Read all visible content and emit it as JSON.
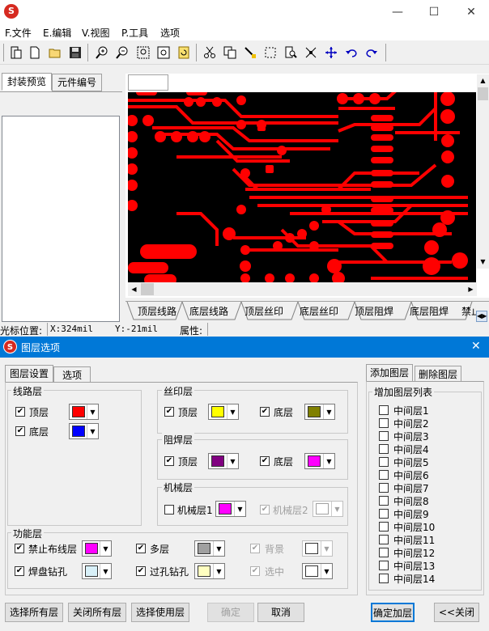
{
  "window": {
    "app_icon": "app-logo-icon",
    "min": "—",
    "max": "☐",
    "close": "✕"
  },
  "menu": [
    "F.文件",
    "E.编辑",
    "V.视图",
    "P.工具",
    "选项"
  ],
  "left_tabs": [
    "封装预览",
    "元件编号"
  ],
  "layer_tabs": [
    "顶层线路",
    "底层线路",
    "顶层丝印",
    "底层丝印",
    "顶层阻焊",
    "底层阻焊",
    "禁止布"
  ],
  "status": {
    "cursor_label": "光标位置:",
    "x": "X:324mil",
    "y": "Y:-21mil",
    "attr_label": "属性:"
  },
  "dialog": {
    "title": "图层选项",
    "close": "✕",
    "tabs": [
      "图层设置",
      "选项"
    ],
    "right_tabs": [
      "添加图层",
      "删除图层"
    ],
    "circuit": {
      "label": "线路层",
      "top": "顶层",
      "bottom": "底层"
    },
    "silk": {
      "label": "丝印层",
      "top": "顶层",
      "bottom": "底层"
    },
    "mask": {
      "label": "阻焊层",
      "top": "顶层",
      "bottom": "底层"
    },
    "mech": {
      "label": "机械层",
      "m1": "机械层1",
      "m2": "机械层2"
    },
    "func": {
      "label": "功能层",
      "keepout": "禁止布线层",
      "multi": "多层",
      "bg": "背景",
      "paddrill": "焊盘钻孔",
      "viadrill": "过孔钻孔",
      "select": "选中"
    },
    "list": {
      "label": "增加图层列表",
      "items": [
        "中间层1",
        "中间层2",
        "中间层3",
        "中间层4",
        "中间层5",
        "中间层6",
        "中间层7",
        "中间层8",
        "中间层9",
        "中间层10",
        "中间层11",
        "中间层12",
        "中间层13",
        "中间层14"
      ]
    },
    "buttons": {
      "select_all": "选择所有层",
      "close_all": "关闭所有层",
      "select_used": "选择使用层",
      "ok": "确定",
      "cancel": "取消",
      "confirm_add": "确定加层",
      "close": "<<关闭"
    }
  },
  "colors": {
    "top": "#ff0000",
    "bottom": "#0000ff",
    "silk_top": "#ffff00",
    "silk_bottom": "#808000",
    "mask_top": "#800080",
    "mask_bottom": "#ff00ff",
    "mech1": "#ff00ff",
    "mech2": "#ffffff",
    "keepout": "#ff00ff",
    "multi": "#a0a0a0",
    "bg": "#ffffff",
    "paddrill": "#d8f0f8",
    "viadrill": "#ffffc0",
    "select": "#ffffff",
    "accent": "#0078d7",
    "pcb_red": "#ff0000"
  }
}
